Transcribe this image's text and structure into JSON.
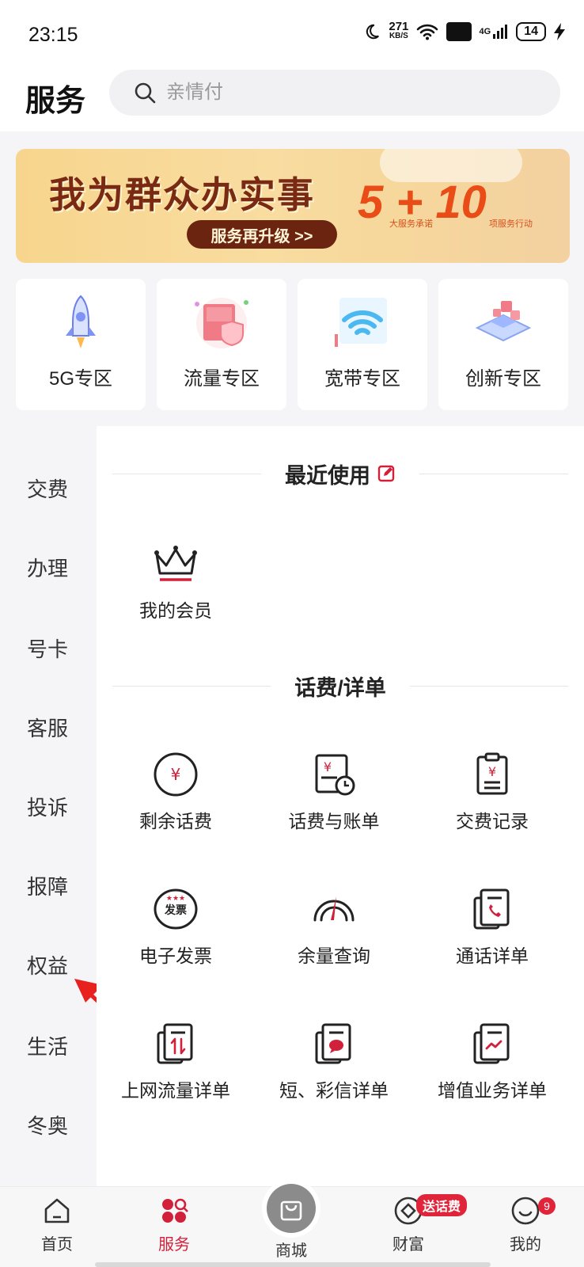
{
  "status_bar": {
    "time": "23:15",
    "speed_value": "271",
    "speed_unit": "KB/S",
    "hd": "HD",
    "network": "4G",
    "battery": "14"
  },
  "header": {
    "title": "服务",
    "search_placeholder": "亲情付"
  },
  "banner": {
    "title": "我为群众办实事",
    "button": "服务再升级 >>",
    "number": "5 + 10",
    "sub1": "大服务承诺",
    "sub2": "项服务行动"
  },
  "zones": [
    {
      "label": "5G专区",
      "icon": "rocket-icon"
    },
    {
      "label": "流量专区",
      "icon": "data-box-icon"
    },
    {
      "label": "宽带专区",
      "icon": "wifi-icon"
    },
    {
      "label": "创新专区",
      "icon": "innovation-icon"
    }
  ],
  "sidebar": [
    "交费",
    "办理",
    "号卡",
    "客服",
    "投诉",
    "报障",
    "权益",
    "生活",
    "冬奥"
  ],
  "recent": {
    "title": "最近使用",
    "items": [
      {
        "label": "我的会员",
        "icon": "crown-icon"
      }
    ]
  },
  "bill": {
    "title": "话费/详单",
    "items": [
      {
        "label": "剩余话费",
        "icon": "yuan-circle-icon"
      },
      {
        "label": "话费与账单",
        "icon": "bill-clock-icon"
      },
      {
        "label": "交费记录",
        "icon": "payment-record-icon"
      },
      {
        "label": "电子发票",
        "icon": "invoice-icon"
      },
      {
        "label": "余量查询",
        "icon": "gauge-icon"
      },
      {
        "label": "通话详单",
        "icon": "call-detail-icon"
      },
      {
        "label": "上网流量详单",
        "icon": "data-detail-icon"
      },
      {
        "label": "短、彩信详单",
        "icon": "sms-detail-icon"
      },
      {
        "label": "增值业务详单",
        "icon": "vas-detail-icon"
      }
    ],
    "invoice_badge": "发票"
  },
  "tabbar": {
    "items": [
      {
        "label": "首页",
        "icon": "home-icon"
      },
      {
        "label": "服务",
        "icon": "service-icon"
      },
      {
        "label": "商城",
        "icon": "shopping-bag-icon"
      },
      {
        "label": "财富",
        "icon": "wealth-icon"
      },
      {
        "label": "我的",
        "icon": "profile-icon"
      }
    ],
    "active": "服务",
    "promo_badge": "送话费",
    "profile_count": "9"
  },
  "colors": {
    "accent": "#d21f3a",
    "banner_brown": "#6b2410",
    "banner_orange": "#e94c16"
  }
}
